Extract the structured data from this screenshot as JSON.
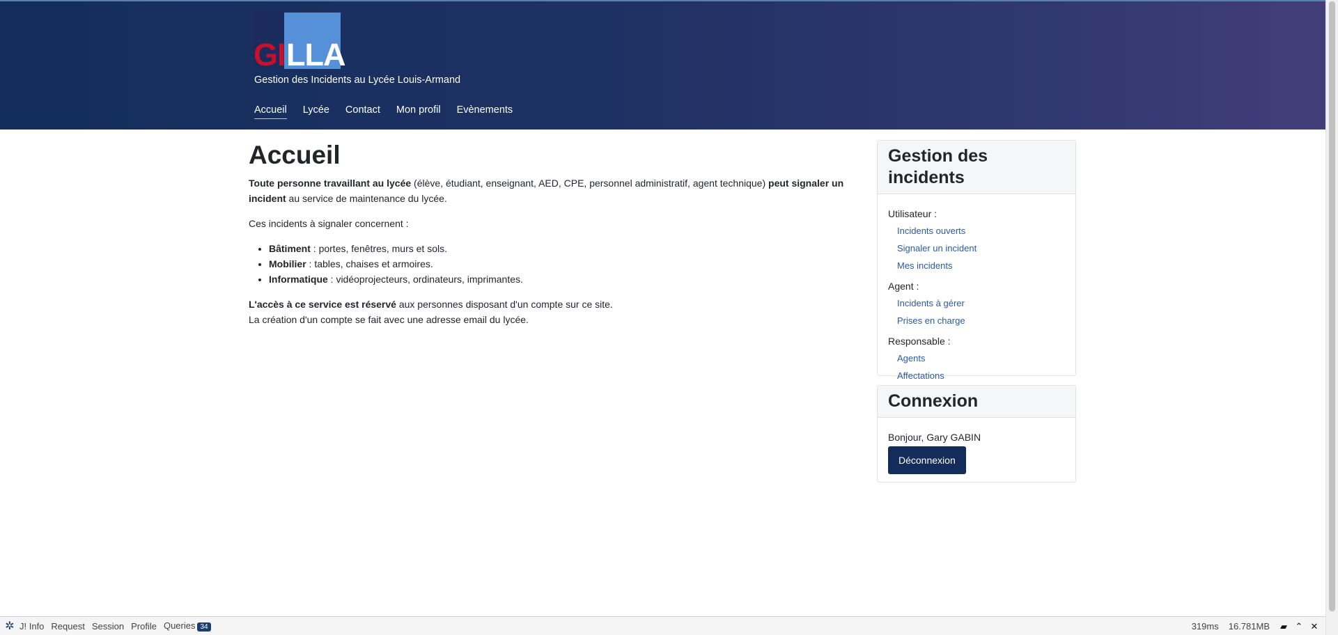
{
  "header": {
    "logo_text_red": "GI",
    "logo_text_white": "LLA",
    "tagline": "Gestion des Incidents au Lycée Louis-Armand",
    "nav": [
      {
        "label": "Accueil",
        "active": true
      },
      {
        "label": "Lycée",
        "active": false
      },
      {
        "label": "Contact",
        "active": false
      },
      {
        "label": "Mon profil",
        "active": false
      },
      {
        "label": "Evènements",
        "active": false
      }
    ]
  },
  "main": {
    "title": "Accueil",
    "intro": {
      "bold1": "Toute personne travaillant au lycée",
      "normal1": " (élève, étudiant, enseignant, AED, CPE, personnel administratif, agent technique) ",
      "bold2": "peut signaler un incident",
      "normal2": " au service de maintenance du lycée."
    },
    "concern": "Ces incidents à signaler concernent :",
    "list": [
      {
        "bold": "Bâtiment",
        "text": " : portes, fenêtres, murs et sols."
      },
      {
        "bold": "Mobilier",
        "text": " : tables, chaises et armoires."
      },
      {
        "bold": "Informatique",
        "text": " : vidéoprojecteurs, ordinateurs, imprimantes."
      }
    ],
    "access": {
      "bold": "L'accès à ce service est réservé",
      "normal": " aux personnes disposant d'un compte sur ce site.",
      "line2": "La création d'un compte se fait avec une adresse email du lycée."
    }
  },
  "sidebar": {
    "incidents": {
      "title": "Gestion des incidents",
      "groups": [
        {
          "label": "Utilisateur :",
          "links": [
            "Incidents ouverts",
            "Signaler un incident",
            "Mes incidents"
          ]
        },
        {
          "label": "Agent :",
          "links": [
            "Incidents à gérer",
            "Prises en charge"
          ]
        },
        {
          "label": "Responsable :",
          "links": [
            "Agents",
            "Affectations"
          ]
        }
      ]
    },
    "login": {
      "title": "Connexion",
      "greeting": "Bonjour, Gary GABIN",
      "logout_label": "Déconnexion"
    }
  },
  "debugbar": {
    "items": [
      "J! Info",
      "Request",
      "Session",
      "Profile",
      "Queries"
    ],
    "queries_count": "34",
    "time": "319ms",
    "memory": "16.781MB"
  },
  "colors": {
    "header_gradient_start": "#132e5b",
    "header_gradient_end": "#433e7a",
    "link": "#2a5aa7",
    "button": "#132c5b",
    "logo_red": "#c8102e",
    "logo_blue": "#5590d9"
  }
}
